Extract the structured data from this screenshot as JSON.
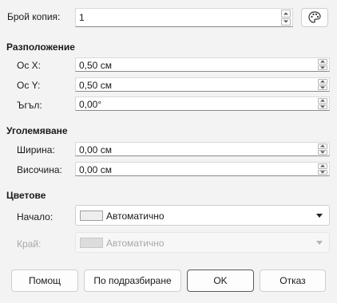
{
  "copies": {
    "label": "Брой копия:",
    "value": "1"
  },
  "placement": {
    "title": "Разположение",
    "x_label": "Ос X:",
    "x_value": "0,50 см",
    "y_label": "Ос Y:",
    "y_value": "0,50 см",
    "angle_label": "Ъгъл:",
    "angle_value": "0,00°"
  },
  "enlargement": {
    "title": "Уголемяване",
    "width_label": "Ширина:",
    "width_value": "0,00 см",
    "height_label": "Височина:",
    "height_value": "0,00 см"
  },
  "colors": {
    "title": "Цветове",
    "start_label": "Начало:",
    "start_value": "Автоматично",
    "end_label": "Край:",
    "end_value": "Автоматично"
  },
  "buttons": {
    "help": "Помощ",
    "defaults": "По подразбиране",
    "ok": "OK",
    "cancel": "Отказ"
  },
  "icons": {
    "values_from_selection": "palette-icon"
  }
}
